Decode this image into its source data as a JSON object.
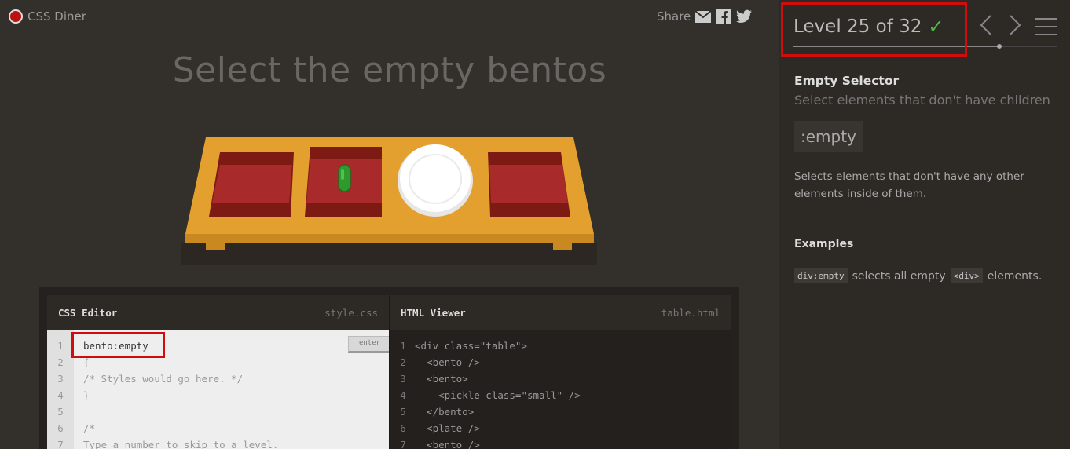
{
  "app": {
    "name": "CSS Diner",
    "share_label": "Share"
  },
  "icons": {
    "logo": "logo-icon",
    "mail": "mail-icon",
    "facebook": "facebook-icon",
    "twitter": "twitter-icon",
    "check": "checkmark-icon",
    "prev": "chevron-left-icon",
    "next": "chevron-right-icon",
    "menu": "hamburger-icon"
  },
  "game": {
    "instruction": "Select the empty bentos"
  },
  "editor": {
    "css_title": "CSS Editor",
    "css_file": "style.css",
    "html_title": "HTML Viewer",
    "html_file": "table.html",
    "enter_label": "enter",
    "css_input": "bento:empty",
    "css_lines": [
      "{",
      "/* Styles would go here. */",
      "}",
      "",
      "/*",
      "Type a number to skip to a level."
    ],
    "css_line_numbers": [
      "1",
      "2",
      "3",
      "4",
      "5",
      "6",
      "7"
    ],
    "html_lines": [
      "<div class=\"table\">",
      "  <bento />",
      "  <bento>",
      "    <pickle class=\"small\" />",
      "  </bento>",
      "  <plate />",
      "  <bento />"
    ],
    "html_line_numbers": [
      "1",
      "2",
      "3",
      "4",
      "5",
      "6",
      "7"
    ]
  },
  "sidebar": {
    "level_text": "Level 25 of 32",
    "level_current": 25,
    "level_total": 32,
    "selector_name": "Empty Selector",
    "selector_desc": "Select elements that don't have children",
    "syntax": ":empty",
    "long_desc": "Selects elements that don't have any other elements inside of them.",
    "examples_title": "Examples",
    "example_code": "div:empty",
    "example_mid": "selects all empty",
    "example_tag": "<div>",
    "example_end": "elements."
  },
  "colors": {
    "accent_check": "#4cb848",
    "highlight": "#d10c0c",
    "table": "#e4a02e",
    "bento": "#a52a2a",
    "pickle": "#2e9a2e"
  }
}
